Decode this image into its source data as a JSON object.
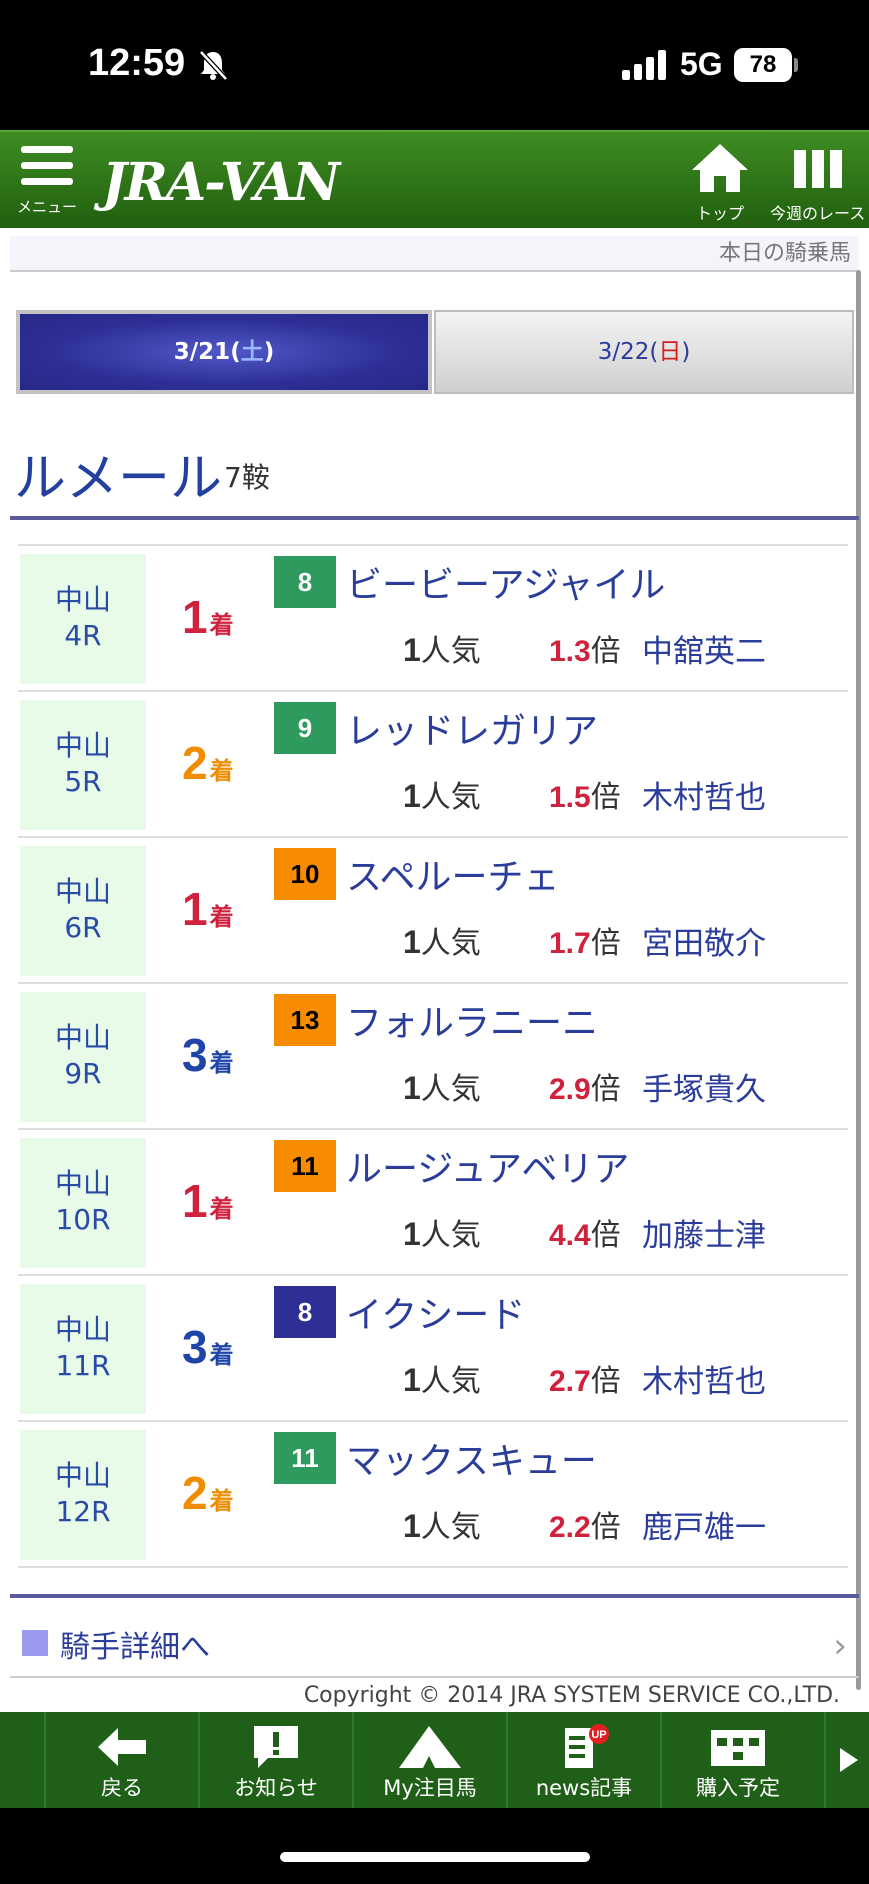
{
  "status": {
    "time": "12:59",
    "network": "5G",
    "battery": "78"
  },
  "header": {
    "menu_label": "メニュー",
    "logo": "JRA-VAN",
    "top_label": "トップ",
    "week_label": "今週のレース"
  },
  "subheader": {
    "title": "本日の騎乗馬"
  },
  "tabs": [
    {
      "date": "3/21",
      "open": "(",
      "day": "土",
      "close": ")",
      "active": true
    },
    {
      "date": "3/22",
      "open": "(",
      "day": "日",
      "close": ")",
      "active": false
    }
  ],
  "jockey": {
    "name": "ルメール",
    "mounts": "7鞍"
  },
  "rows": [
    {
      "course": "中山",
      "race": "4R",
      "place": "1",
      "place_suffix": "着",
      "place_color": "#d0213d",
      "num": "8",
      "num_bg": "#2f9a5e",
      "num_color": "#ffffff",
      "horse": "ビービーアジャイル",
      "pop": "1",
      "pop_suffix": "人気",
      "odds": "1.3",
      "odds_suffix": "倍",
      "rider": "中舘英二"
    },
    {
      "course": "中山",
      "race": "5R",
      "place": "2",
      "place_suffix": "着",
      "place_color": "#f08c00",
      "num": "9",
      "num_bg": "#2f9a5e",
      "num_color": "#ffffff",
      "horse": "レッドレガリア",
      "pop": "1",
      "pop_suffix": "人気",
      "odds": "1.5",
      "odds_suffix": "倍",
      "rider": "木村哲也"
    },
    {
      "course": "中山",
      "race": "6R",
      "place": "1",
      "place_suffix": "着",
      "place_color": "#d0213d",
      "num": "10",
      "num_bg": "#f78c00",
      "num_color": "#000000",
      "horse": "スペルーチェ",
      "pop": "1",
      "pop_suffix": "人気",
      "odds": "1.7",
      "odds_suffix": "倍",
      "rider": "宮田敬介"
    },
    {
      "course": "中山",
      "race": "9R",
      "place": "3",
      "place_suffix": "着",
      "place_color": "#1f45a8",
      "num": "13",
      "num_bg": "#f78c00",
      "num_color": "#000000",
      "horse": "フォルラニーニ",
      "pop": "1",
      "pop_suffix": "人気",
      "odds": "2.9",
      "odds_suffix": "倍",
      "rider": "手塚貴久"
    },
    {
      "course": "中山",
      "race": "10R",
      "place": "1",
      "place_suffix": "着",
      "place_color": "#d0213d",
      "num": "11",
      "num_bg": "#f78c00",
      "num_color": "#000000",
      "horse": "ルージュアベリア",
      "pop": "1",
      "pop_suffix": "人気",
      "odds": "4.4",
      "odds_suffix": "倍",
      "rider": "加藤士津"
    },
    {
      "course": "中山",
      "race": "11R",
      "place": "3",
      "place_suffix": "着",
      "place_color": "#1f45a8",
      "num": "8",
      "num_bg": "#2d2f96",
      "num_color": "#ffffff",
      "horse": "イクシード",
      "pop": "1",
      "pop_suffix": "人気",
      "odds": "2.7",
      "odds_suffix": "倍",
      "rider": "木村哲也"
    },
    {
      "course": "中山",
      "race": "12R",
      "place": "2",
      "place_suffix": "着",
      "place_color": "#f08c00",
      "num": "11",
      "num_bg": "#2f9a5e",
      "num_color": "#ffffff",
      "horse": "マックスキュー",
      "pop": "1",
      "pop_suffix": "人気",
      "odds": "2.2",
      "odds_suffix": "倍",
      "rider": "鹿戸雄一"
    }
  ],
  "detail_link": {
    "label": "騎手詳細へ",
    "chevron": "›"
  },
  "copyright": "Copyright © 2014 JRA SYSTEM SERVICE CO.,LTD.",
  "bottom_nav": [
    {
      "label": "戻る",
      "icon": "back-arrow-icon"
    },
    {
      "label": "お知らせ",
      "icon": "notice-icon"
    },
    {
      "label": "My注目馬",
      "icon": "my-horse-icon"
    },
    {
      "label": "news記事",
      "icon": "news-icon",
      "badge": "UP"
    },
    {
      "label": "購入予定",
      "icon": "purchase-plan-icon"
    }
  ]
}
